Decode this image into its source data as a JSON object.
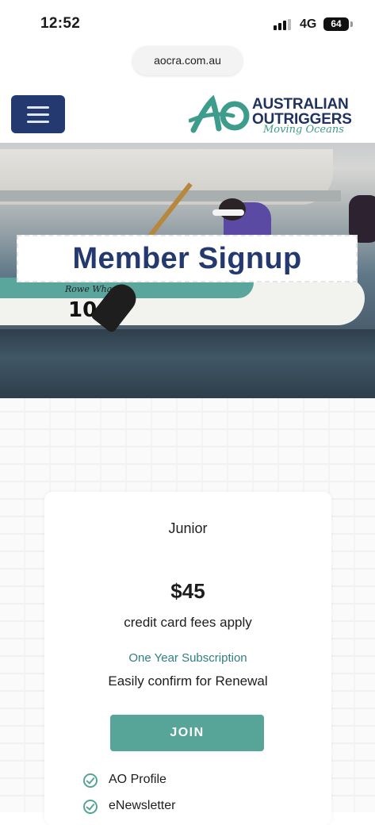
{
  "status_bar": {
    "time": "12:52",
    "network": "4G",
    "battery": "64"
  },
  "browser": {
    "url": "aocra.com.au"
  },
  "header": {
    "menu_icon": "hamburger-menu-icon",
    "logo": {
      "line1": "AUSTRALIAN",
      "line2": "OUTRIGGERS",
      "tagline": "Moving Oceans"
    }
  },
  "hero": {
    "title": "Member Signup",
    "canoe_number": "10",
    "canoe_name": "Rowe Wha"
  },
  "plan": {
    "name": "Junior",
    "price": "$45",
    "fees_note": "credit card fees apply",
    "term": "One Year Subscription",
    "renewal_note": "Easily confirm for Renewal",
    "join_label": "JOIN",
    "features": [
      "AO Profile",
      "eNewsletter"
    ]
  },
  "colors": {
    "navy": "#24396f",
    "teal": "#57a498",
    "term_text": "#2f7f86"
  }
}
